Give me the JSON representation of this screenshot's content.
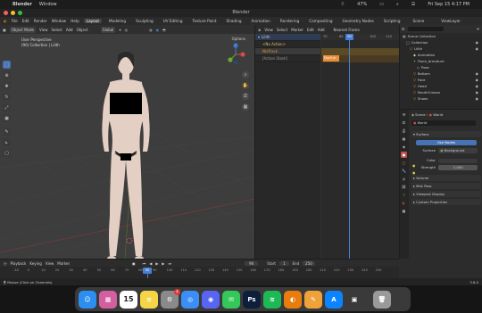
{
  "menubar": {
    "apple": "",
    "app": "Blender",
    "window_menu": "Window",
    "battery": "47%",
    "datetime": "Fri Sep 15  4:17 PM"
  },
  "window": {
    "title": "Blender"
  },
  "blender_menu": {
    "items": [
      "File",
      "Edit",
      "Render",
      "Window",
      "Help"
    ],
    "tabs": [
      "Layout",
      "Modeling",
      "Sculpting",
      "UV Editing",
      "Texture Paint",
      "Shading",
      "Animation",
      "Rendering",
      "Compositing",
      "Geometry Nodes",
      "Scripting"
    ],
    "active_tab": "Layout",
    "scene": "Scene",
    "view_layer": "ViewLayer"
  },
  "viewport": {
    "mode": "Object Mode",
    "menus": [
      "View",
      "Select",
      "Add",
      "Object"
    ],
    "transform": "Global",
    "options": "Options",
    "info_line1": "User Perspective",
    "info_line2": "(90) Collection | Lilith"
  },
  "nla": {
    "menus": [
      "View",
      "Select",
      "Marker",
      "Edit",
      "Add"
    ],
    "snap": "Nearest Frame",
    "channels": [
      "Lilith",
      "<No Action>",
      "NlaTrack",
      "[Action Stash]"
    ],
    "strip_label": "Fbx9.m",
    "ruler_ticks": [
      "70",
      "80",
      "90",
      "100",
      "110"
    ],
    "current_frame": "90"
  },
  "outliner": {
    "search_placeholder": "",
    "items": [
      "Scene Collection",
      "Collection",
      "Lilith",
      "Animation",
      "Rune_Armature",
      "Pose",
      "Bottom",
      "Face",
      "Head",
      "MouthCrease",
      "Shoes"
    ]
  },
  "properties": {
    "breadcrumb_scene": "Scene",
    "breadcrumb_world": "World",
    "world_name": "World",
    "panel_surface": "Surface",
    "use_nodes": "Use Nodes",
    "surface_label": "Surface",
    "surface_value": "Background",
    "color_label": "Color",
    "strength_label": "Strength",
    "strength_value": "1.000",
    "panels": [
      "Volume",
      "Mist Pass",
      "Viewport Display",
      "Custom Properties"
    ]
  },
  "timeline": {
    "menus": [
      "Playback",
      "Keying",
      "View",
      "Marker"
    ],
    "ticks": [
      "-30",
      "0",
      "10",
      "20",
      "30",
      "40",
      "50",
      "60",
      "70",
      "80",
      "90",
      "100",
      "110",
      "120",
      "130",
      "140",
      "150",
      "160",
      "170",
      "180",
      "190",
      "200",
      "210",
      "220",
      "230",
      "240",
      "250"
    ],
    "current_frame": "90",
    "start_label": "Start",
    "start_value": "1",
    "end_label": "End",
    "end_value": "250"
  },
  "statusbar": {
    "left": "Mouse (Click on Channels)",
    "right": "3.6.0"
  },
  "dock": {
    "apps": [
      {
        "name": "Finder",
        "color": "#2b8ef0",
        "glyph": "☺"
      },
      {
        "name": "Launchpad",
        "color": "#d45fa0",
        "glyph": "▦"
      },
      {
        "name": "Calendar",
        "color": "#ffffff",
        "glyph": "15"
      },
      {
        "name": "Notes",
        "color": "#f5d547",
        "glyph": "≡"
      },
      {
        "name": "System Settings",
        "color": "#8a8a8a",
        "glyph": "⚙"
      },
      {
        "name": "Safari",
        "color": "#3a8ef5",
        "glyph": "◎"
      },
      {
        "name": "Discord",
        "color": "#5865f2",
        "glyph": "◉"
      },
      {
        "name": "Messages",
        "color": "#34c759",
        "glyph": "✉"
      },
      {
        "name": "Photoshop",
        "color": "#0e1f3c",
        "glyph": "Ps"
      },
      {
        "name": "Spotify",
        "color": "#1db954",
        "glyph": "≋"
      },
      {
        "name": "Blender",
        "color": "#e87d0d",
        "glyph": "◐"
      },
      {
        "name": "Pages",
        "color": "#f0a23a",
        "glyph": "✎"
      },
      {
        "name": "App Store",
        "color": "#0a84ff",
        "glyph": "A"
      },
      {
        "name": "Quick Look",
        "color": "#3a3a3a",
        "glyph": "▣"
      },
      {
        "name": "Trash",
        "color": "#9a9a9a",
        "glyph": "🗑"
      }
    ],
    "badge_calendar": "",
    "badge_settings": "1"
  }
}
